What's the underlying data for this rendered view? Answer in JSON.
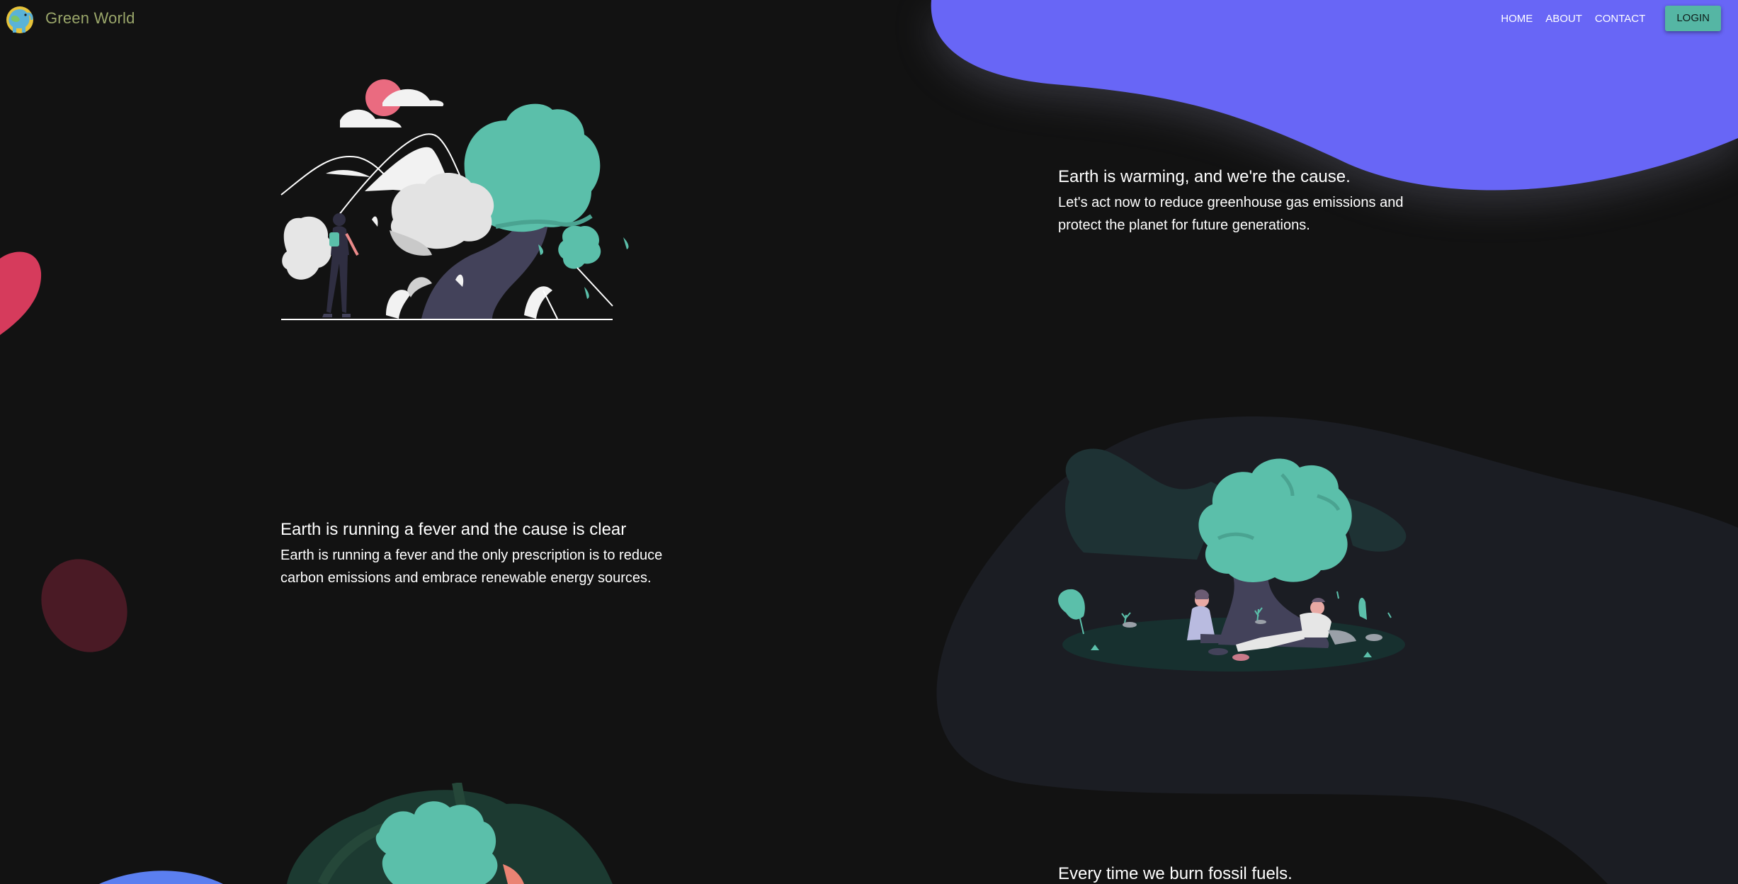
{
  "brand": {
    "name": "Green World",
    "logo_icon": "elephant-globe-logo"
  },
  "nav": {
    "links": [
      "HOME",
      "ABOUT",
      "CONTACT"
    ],
    "login_label": "LOGIN"
  },
  "sections": [
    {
      "title": "Earth is warming, and we're the cause.",
      "body": "Let's act now to reduce greenhouse gas emissions and protect the planet for future generations."
    },
    {
      "title": "Earth is running a fever and the cause is clear",
      "body": "Earth is running a fever and the only prescription is to reduce carbon emissions and embrace renewable energy sources."
    },
    {
      "title": "Every time we burn fossil fuels."
    }
  ],
  "colors": {
    "background": "#121212",
    "accent_blob": "#6866f6",
    "teal": "#5bbfaa",
    "pink_blob": "#d63b5c",
    "dark_blob": "#1b1d23",
    "login_button": "#55b6a4"
  }
}
